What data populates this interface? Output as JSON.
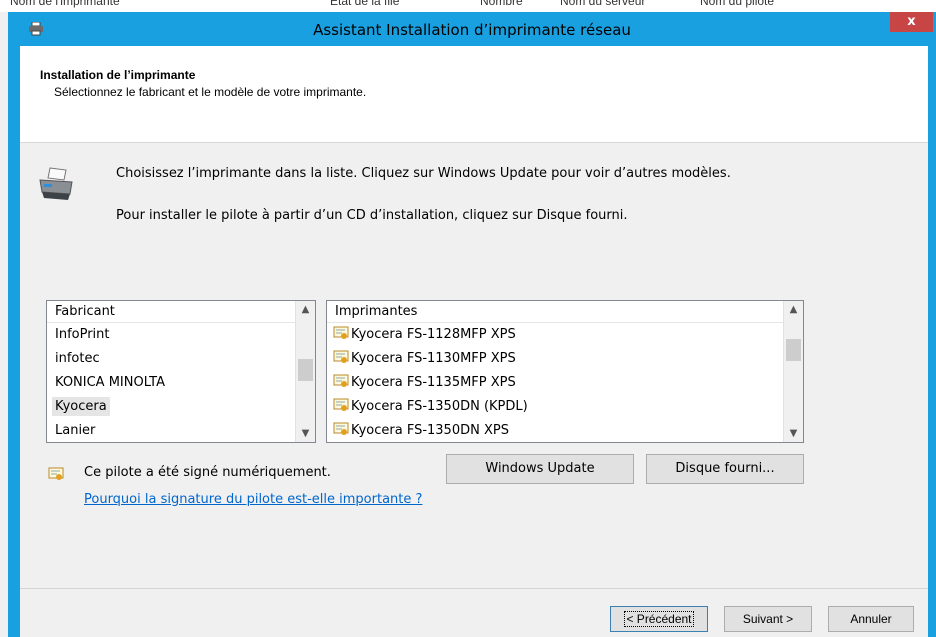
{
  "background_breadcrumb": {
    "items": [
      "Nom de l'imprimante",
      "État de la file",
      "Nombre",
      "Nom du serveur",
      "Nom du pilote"
    ]
  },
  "window": {
    "title": "Assistant Installation d’imprimante réseau",
    "close_label": "x",
    "accent_color": "#19a0e0"
  },
  "header": {
    "title": "Installation de l’imprimante",
    "subtitle": "Sélectionnez le fabricant et le modèle de votre imprimante."
  },
  "intro": {
    "line1": "Choisissez l’imprimante dans la liste. Cliquez sur Windows Update pour voir d’autres modèles.",
    "line2": "Pour installer le pilote à partir d’un CD d’installation, cliquez sur Disque fourni."
  },
  "manufacturers": {
    "header": "Fabricant",
    "items": [
      "InfoPrint",
      "infotec",
      "KONICA MINOLTA",
      "Kyocera",
      "Lanier"
    ],
    "selected": "Kyocera"
  },
  "printers": {
    "header": "Imprimantes",
    "items": [
      "Kyocera FS-1128MFP XPS",
      "Kyocera FS-1130MFP XPS",
      "Kyocera FS-1135MFP XPS",
      "Kyocera FS-1350DN (KPDL)",
      "Kyocera FS-1350DN XPS"
    ]
  },
  "signature": {
    "text": "Ce pilote a été signé numériquement.",
    "link": "Pourquoi la signature du pilote est-elle importante ?"
  },
  "buttons": {
    "windows_update": "Windows Update",
    "have_disk": "Disque fourni...",
    "back": "< Précédent",
    "next": "Suivant >",
    "cancel": "Annuler"
  },
  "icons": {
    "window": "printer-icon",
    "close": "close-icon",
    "large": "printer-large-icon",
    "driver": "certificate-icon"
  }
}
